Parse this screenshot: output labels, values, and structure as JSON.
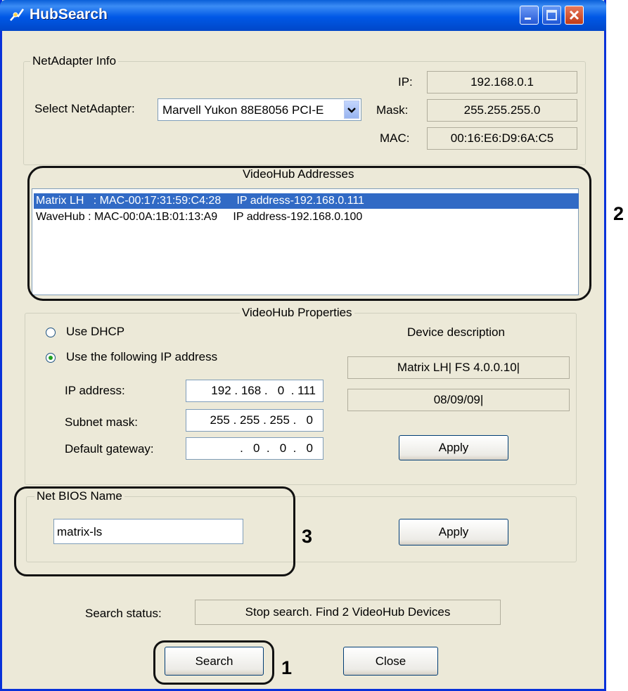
{
  "window": {
    "title": "HubSearch"
  },
  "netadapter": {
    "group_label": "NetAdapter Info",
    "select_label": "Select NetAdapter:",
    "selected_adapter": "Marvell Yukon 88E8056 PCI-E",
    "ip_label": "IP:",
    "ip_value": "192.168.0.1",
    "mask_label": "Mask:",
    "mask_value": "255.255.255.0",
    "mac_label": "MAC:",
    "mac_value": "00:16:E6:D9:6A:C5"
  },
  "addresses": {
    "group_label": "VideoHub Addresses",
    "rows": [
      {
        "text": "Matrix LH   : MAC-00:17:31:59:C4:28     IP address-192.168.0.111",
        "selected": true
      },
      {
        "text": "WaveHub : MAC-00:0A:1B:01:13:A9     IP address-192.168.0.100",
        "selected": false
      }
    ]
  },
  "properties": {
    "group_label": "VideoHub Properties",
    "radio_dhcp": "Use DHCP",
    "radio_static": "Use the following IP address",
    "ip_label": "IP address:",
    "ip_value": "192 . 168 .   0  . 111",
    "subnet_label": "Subnet mask:",
    "subnet_value": "255 . 255 . 255 .   0",
    "gateway_label": "Default gateway:",
    "gateway_value": ".   0  .   0  .   0",
    "device_desc_label": "Device description",
    "device_name": "Matrix LH| FS 4.0.0.10|",
    "device_date": "08/09/09|",
    "apply_label": "Apply"
  },
  "netbios": {
    "group_label": "Net BIOS Name",
    "name_value": "matrix-ls",
    "apply_label": "Apply"
  },
  "status": {
    "label": "Search status:",
    "value": "Stop search. Find 2 VideoHub Devices"
  },
  "buttons": {
    "search": "Search",
    "close": "Close"
  },
  "annotations": {
    "n1": "1",
    "n2": "2",
    "n3": "3"
  }
}
